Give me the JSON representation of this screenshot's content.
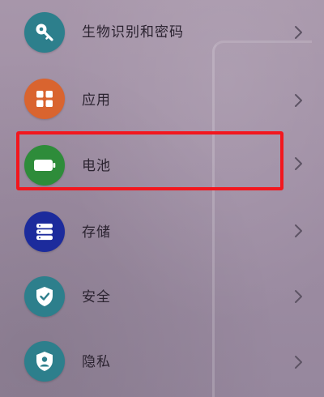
{
  "settings": {
    "items": [
      {
        "label": "生物识别和密码",
        "icon": "key-icon",
        "color": "#2d7f8c"
      },
      {
        "label": "应用",
        "icon": "grid-icon",
        "color": "#d9642f"
      },
      {
        "label": "电池",
        "icon": "battery-icon",
        "color": "#2e8c3a"
      },
      {
        "label": "存储",
        "icon": "storage-icon",
        "color": "#1c2b9c"
      },
      {
        "label": "安全",
        "icon": "shield-icon",
        "color": "#2d7f8c"
      },
      {
        "label": "隐私",
        "icon": "privacy-icon",
        "color": "#2d7f8c"
      }
    ],
    "highlighted_item": "电池",
    "highlight_color": "#f2171e"
  }
}
